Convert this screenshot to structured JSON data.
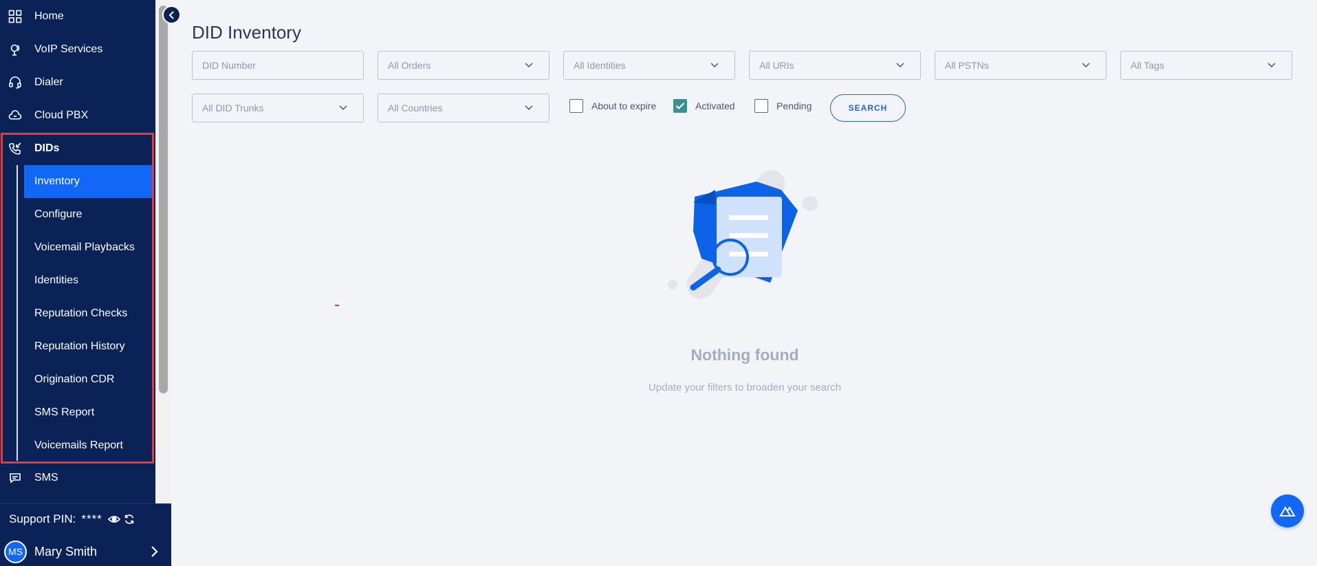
{
  "sidebar": {
    "nav": [
      {
        "label": "Home",
        "icon": "grid-icon"
      },
      {
        "label": "VoIP Services",
        "icon": "voip-icon"
      },
      {
        "label": "Dialer",
        "icon": "headset-icon"
      },
      {
        "label": "Cloud PBX",
        "icon": "cloud-phone-icon"
      },
      {
        "label": "DIDs",
        "icon": "phone-incoming-icon"
      },
      {
        "label": "SMS",
        "icon": "sms-icon"
      }
    ],
    "dids_items": [
      {
        "label": "Inventory",
        "active": true
      },
      {
        "label": "Configure"
      },
      {
        "label": "Voicemail Playbacks"
      },
      {
        "label": "Identities"
      },
      {
        "label": "Reputation Checks"
      },
      {
        "label": "Reputation History"
      },
      {
        "label": "Origination CDR"
      },
      {
        "label": "SMS Report"
      },
      {
        "label": "Voicemails Report"
      }
    ],
    "support_pin_label": "Support PIN:",
    "support_pin_value": "****",
    "user": {
      "initials": "MS",
      "name": "Mary Smith"
    }
  },
  "page": {
    "title": "DID Inventory"
  },
  "filters": {
    "did_number_placeholder": "DID Number",
    "orders": "All Orders",
    "identities": "All Identities",
    "uris": "All URIs",
    "pstns": "All PSTNs",
    "tags": "All Tags",
    "did_trunks": "All DID Trunks",
    "countries": "All Countries",
    "about_to_expire": {
      "label": "About to expire",
      "checked": false
    },
    "activated": {
      "label": "Activated",
      "checked": true
    },
    "pending": {
      "label": "Pending",
      "checked": false
    },
    "search_label": "SEARCH"
  },
  "empty_state": {
    "title": "Nothing found",
    "subtitle": "Update your filters to broaden your search"
  },
  "colors": {
    "sidebar_bg": "#0a2255",
    "accent": "#1267f7",
    "highlight_border": "#e8383a",
    "check_teal": "#3a8f94"
  }
}
